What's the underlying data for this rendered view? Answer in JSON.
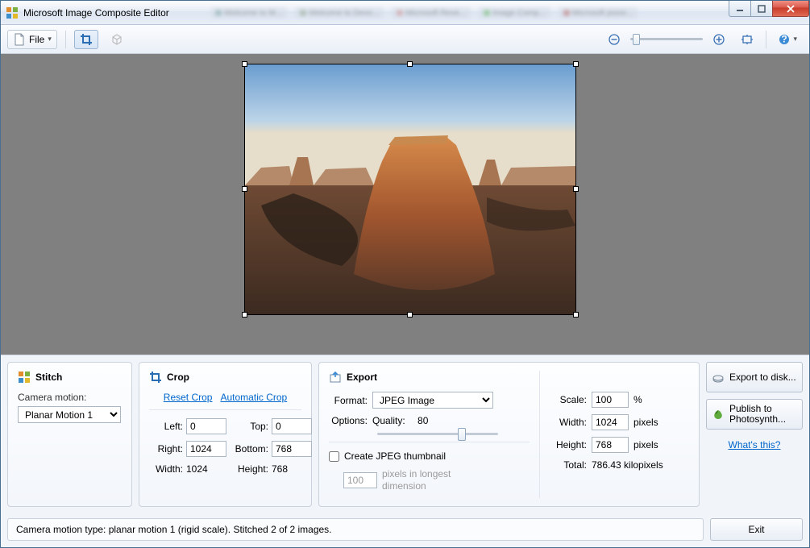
{
  "app": {
    "title": "Microsoft Image Composite Editor"
  },
  "toolbar": {
    "file_label": "File"
  },
  "stitch": {
    "heading": "Stitch",
    "camera_motion_label": "Camera motion:",
    "camera_motion_value": "Planar Motion 1"
  },
  "crop": {
    "heading": "Crop",
    "reset_label": "Reset Crop",
    "auto_label": "Automatic Crop",
    "left_label": "Left:",
    "left_value": "0",
    "top_label": "Top:",
    "top_value": "0",
    "right_label": "Right:",
    "right_value": "1024",
    "bottom_label": "Bottom:",
    "bottom_value": "768",
    "width_label": "Width:",
    "width_value": "1024",
    "height_label": "Height:",
    "height_value": "768"
  },
  "export": {
    "heading": "Export",
    "format_label": "Format:",
    "format_value": "JPEG Image",
    "options_label": "Options:",
    "quality_label": "Quality:",
    "quality_value": "80",
    "thumb_label": "Create JPEG thumbnail",
    "thumb_px_value": "100",
    "thumb_px_label": "pixels in longest dimension",
    "scale_label": "Scale:",
    "scale_value": "100",
    "scale_unit": "%",
    "width_label": "Width:",
    "width_value": "1024",
    "px": "pixels",
    "height_label": "Height:",
    "height_value": "768",
    "total_label": "Total:",
    "total_value": "786.43 kilopixels"
  },
  "side": {
    "export_disk": "Export to disk...",
    "publish": "Publish to Photosynth...",
    "whats": "What's this?"
  },
  "status": {
    "text": "Camera motion type: planar motion 1 (rigid scale). Stitched 2 of 2 images."
  },
  "footer": {
    "exit": "Exit"
  }
}
